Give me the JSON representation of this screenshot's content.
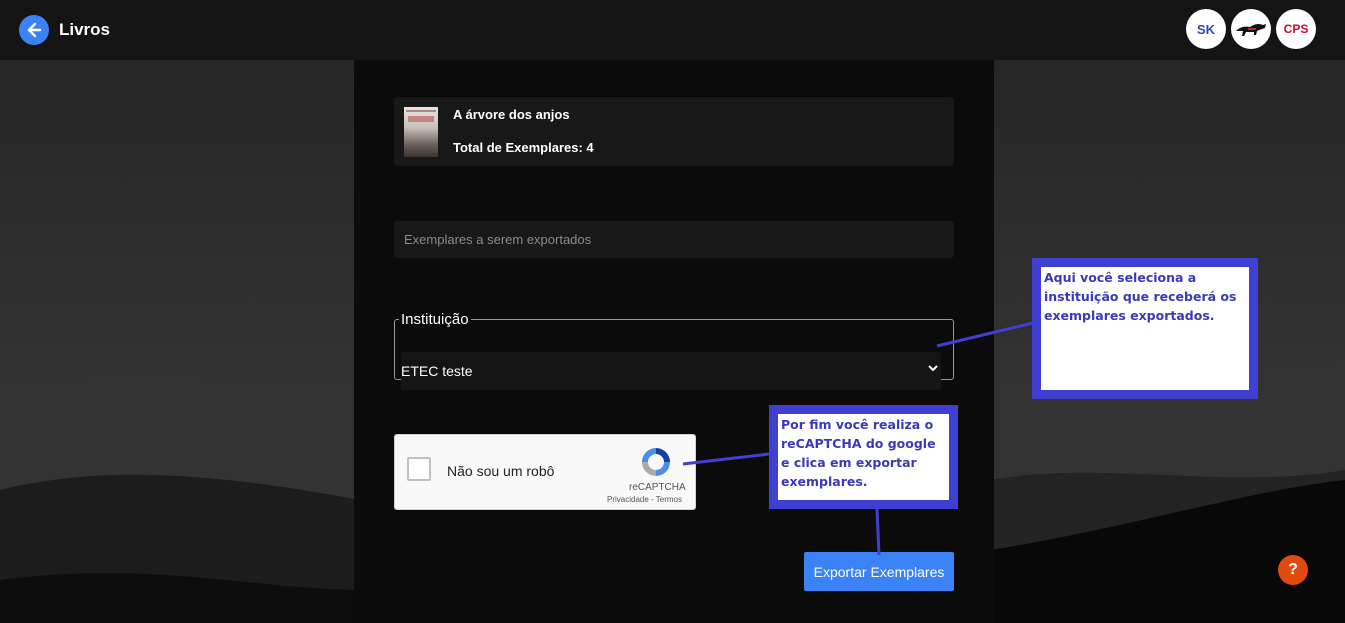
{
  "header": {
    "title": "Livros",
    "logos": [
      "SK",
      "",
      "CPS"
    ]
  },
  "book": {
    "title": "A árvore dos anjos",
    "total_label": "Total de Exemplares: 4",
    "cover_text": "A árvore dos anjos"
  },
  "export_field": {
    "placeholder": "Exemplares a serem exportados",
    "value": ""
  },
  "institution": {
    "legend": "Instituição",
    "selected": "ETEC teste"
  },
  "recaptcha": {
    "label": "Não sou um robô",
    "brand": "reCAPTCHA",
    "links": "Privacidade - Termos"
  },
  "export_button": {
    "label": "Exportar Exemplares"
  },
  "help_button": {
    "label": "?"
  },
  "annotations": [
    {
      "text": "Aqui você seleciona a instituição que receberá os exemplares exportados."
    },
    {
      "text": "Por fim você realiza o reCAPTCHA do google e clica em exportar exemplares."
    }
  ],
  "colors": {
    "accent": "#3b82f6",
    "help": "#e04a0c",
    "callout_border": "#3f3fd1",
    "callout_text": "#3a3ab8"
  }
}
